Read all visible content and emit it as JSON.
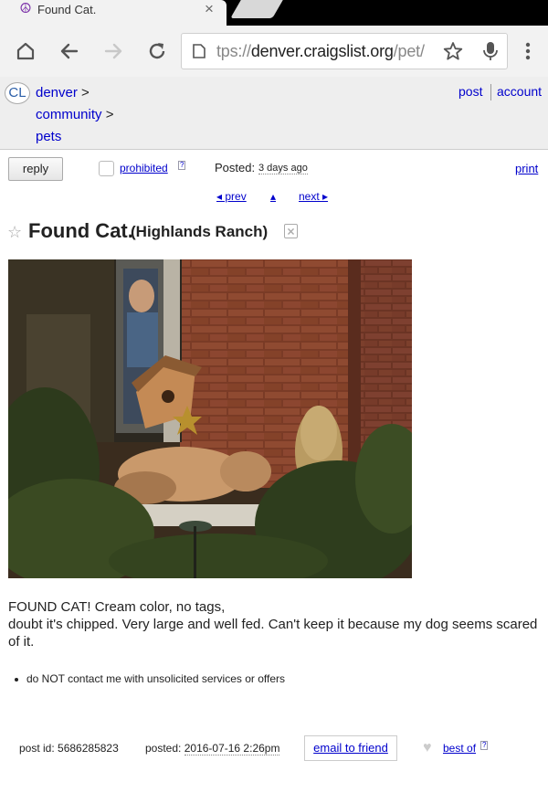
{
  "browser": {
    "tab_title": "Found Cat.",
    "tab_close": "×",
    "url_prefix": "tps://",
    "url_host": "denver.craigslist.org",
    "url_path": "/pet/"
  },
  "header": {
    "logo": "CL",
    "breadcrumbs": [
      {
        "label": "denver",
        "sep": " >"
      },
      {
        "label": "community",
        "sep": " >"
      },
      {
        "label": "pets",
        "sep": ""
      }
    ],
    "post_link": "post",
    "account_link": "account"
  },
  "postbar": {
    "reply_label": "reply",
    "prohibited_label": "prohibited",
    "help_mark": "?",
    "posted_label": "Posted:",
    "posted_relative": "3 days ago",
    "print_label": "print",
    "prev_label": "◂ prev",
    "up_label": "▴",
    "next_label": "next ▸"
  },
  "posting": {
    "star": "☆",
    "title": "Found Cat.",
    "location": "(Highlands Ranch)",
    "body_line1": "FOUND CAT! Cream color, no tags,",
    "body_line2": "doubt it's chipped. Very large and well fed. Can't keep it because my dog seems scared of it.",
    "notice": "do NOT contact me with unsolicited services or offers"
  },
  "footer": {
    "post_id_label": "post id: 5686285823",
    "posted_label": "posted:",
    "posted_date": "2016-07-16 2:26pm",
    "email_label": "email to friend",
    "heart": "♥",
    "bestof_label": "best of",
    "help_mark": "?"
  }
}
